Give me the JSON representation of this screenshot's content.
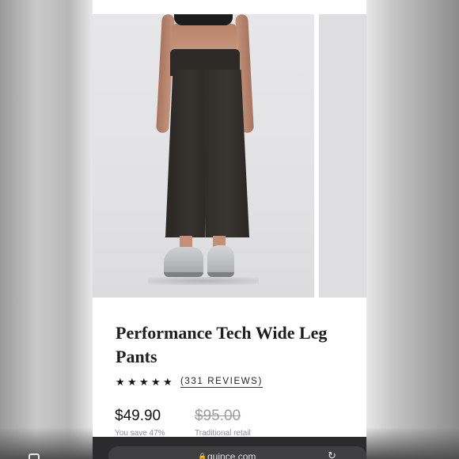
{
  "product": {
    "title": "Performance Tech Wide Leg Pants",
    "rating_stars": 5,
    "reviews_label": "(331 REVIEWS)",
    "price": "$49.90",
    "original_price": "$95.00",
    "savings_label": "You save 47%",
    "retail_label": "Traditional retail"
  },
  "browser": {
    "url": "quince.com",
    "icons": [
      "tabs-icon",
      "lock-icon",
      "share-icon"
    ]
  },
  "colors": {
    "text": "#1e1e1e",
    "muted": "#8f8f8f",
    "strike": "#9b9b9b",
    "browser_bar": "#2b2b2d"
  }
}
